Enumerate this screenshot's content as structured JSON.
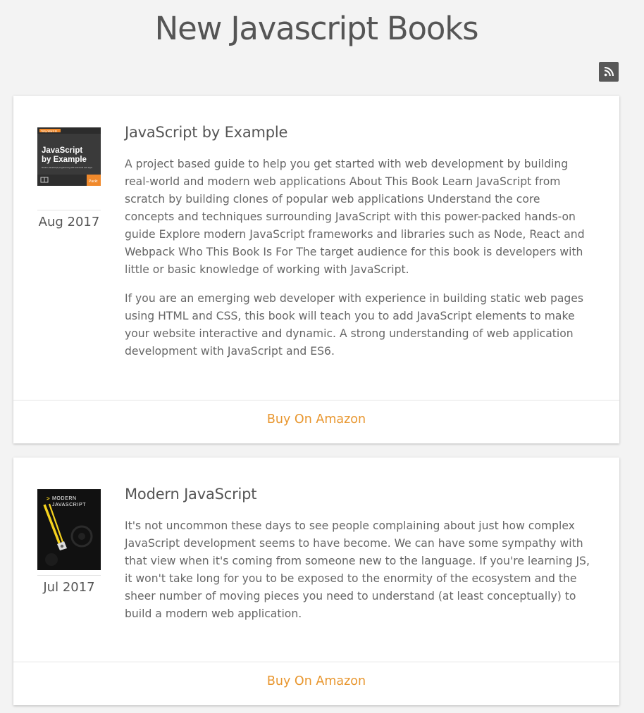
{
  "page": {
    "title": "New Javascript Books"
  },
  "header": {
    "rss_icon": "rss-icon"
  },
  "books": [
    {
      "cover": {
        "author_line": "Toby Ward B",
        "title_line1": "JavaScript",
        "title_line2": "by Example",
        "tagline": "Modern JavaScript programming with real world web apps",
        "publisher": "Packt",
        "colors": {
          "background": "#3a3a3a",
          "accent": "#f0892b"
        }
      },
      "date": "Aug 2017",
      "title": "JavaScript by Example",
      "description": [
        "A project based guide to help you get started with web development by building real-world and modern web applications About This Book Learn JavaScript from scratch by building clones of popular web applications Understand the core concepts and techniques surrounding JavaScript with this power-packed hands-on guide Explore modern JavaScript frameworks and libraries such as Node, React and Webpack Who This Book Is For The target audience for this book is developers with little or basic knowledge of working with JavaScript.",
        "If you are an emerging web developer with experience in building static web pages using HTML and CSS, this book will teach you to add JavaScript elements to make your website interactive and dynamic. A strong understanding of web application development with JavaScript and ES6."
      ],
      "buy_label": "Buy On Amazon"
    },
    {
      "cover": {
        "line1": "MODERN",
        "line2": "JAVASCRIPT",
        "colors": {
          "background": "#111111",
          "accent": "#f5d21e"
        }
      },
      "date": "Jul 2017",
      "title": "Modern JavaScript",
      "description": [
        "It's not uncommon these days to see people complaining about just how complex JavaScript development seems to have become. We can have some sympathy with that view when it's coming from someone new to the language. If you're learning JS, it won't take long for you to be exposed to the enormity of the ecosystem and the sheer number of moving pieces you need to understand (at least conceptually) to build a modern web application."
      ],
      "buy_label": "Buy On Amazon"
    }
  ],
  "theme": {
    "link_color": "#e8962e",
    "background": "#f3f3f3"
  }
}
